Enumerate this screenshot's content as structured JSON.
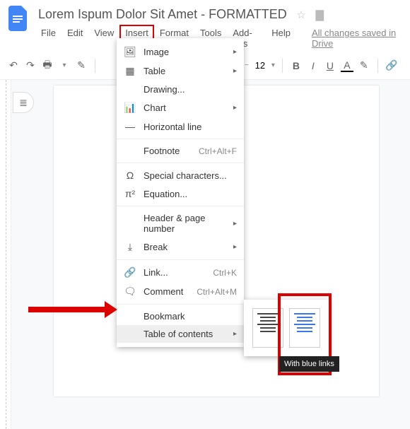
{
  "doc": {
    "title": "Lorem Ispum Dolor Sit Amet - FORMATTED",
    "save_status": "All changes saved in Drive"
  },
  "menubar": [
    "File",
    "Edit",
    "View",
    "Insert",
    "Format",
    "Tools",
    "Add-ons",
    "Help"
  ],
  "active_menu_index": 3,
  "toolbar": {
    "font_size": "12"
  },
  "insert_menu": [
    {
      "icon": "🖼",
      "label": "Image",
      "submenu": true
    },
    {
      "icon": "▦",
      "label": "Table",
      "submenu": true
    },
    {
      "icon": "",
      "label": "Drawing..."
    },
    {
      "icon": "📊",
      "label": "Chart",
      "submenu": true
    },
    {
      "icon": "—",
      "label": "Horizontal line"
    },
    {
      "divider": true
    },
    {
      "icon": "",
      "label": "Footnote",
      "shortcut": "Ctrl+Alt+F"
    },
    {
      "divider": true
    },
    {
      "icon": "Ω",
      "label": "Special characters..."
    },
    {
      "icon": "π²",
      "label": "Equation..."
    },
    {
      "divider": true
    },
    {
      "icon": "",
      "label": "Header & page number",
      "submenu": true
    },
    {
      "icon": "⤓",
      "label": "Break",
      "submenu": true
    },
    {
      "divider": true
    },
    {
      "icon": "🔗",
      "label": "Link...",
      "shortcut": "Ctrl+K"
    },
    {
      "icon": "🗨",
      "label": "Comment",
      "shortcut": "Ctrl+Alt+M"
    },
    {
      "divider": true
    },
    {
      "icon": "",
      "label": "Bookmark"
    },
    {
      "icon": "",
      "label": "Table of contents",
      "submenu": true,
      "hover": true
    }
  ],
  "toc_tooltip": "With blue links"
}
